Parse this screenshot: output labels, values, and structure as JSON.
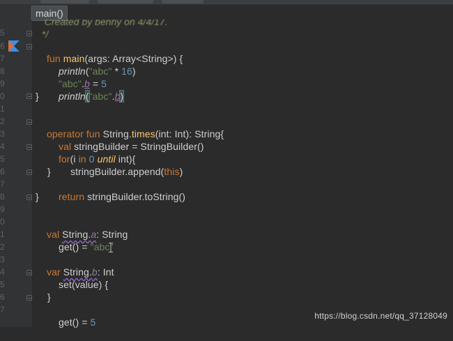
{
  "breadcrumb": "main()",
  "ghost_comment": {
    "line1": "  Created by benny on 4/4/17.",
    "line2": " */"
  },
  "gutter": {
    "line_numbers": [
      "5",
      "6",
      "7",
      "8",
      "9",
      "0",
      "1",
      "2",
      "3",
      "4",
      "5",
      "6",
      "7",
      "8",
      "9",
      "0",
      "1",
      "2",
      "3",
      "4",
      "5",
      "6",
      "7"
    ]
  },
  "code": {
    "l6": {
      "kw": "fun",
      "name": "main",
      "rest": "(args: Array<String>) {"
    },
    "l7": {
      "fn": "println",
      "open": "(",
      "str": "\"abc\"",
      "op": " * ",
      "num": "16",
      "close": ")"
    },
    "l8": {
      "str": "\"abc\"",
      "dot": ".",
      "prop": "b",
      "op": " = ",
      "num": "5"
    },
    "l9": {
      "fn": "println",
      "open": "(",
      "str": "\"abc\"",
      "dot": ".",
      "prop": "b",
      "close": ")"
    },
    "l10": "}",
    "l12": {
      "kw": "operator fun ",
      "type": "String.",
      "name": "times",
      "rest": "(int: Int): String{"
    },
    "l13": {
      "kw": "val ",
      "rest": "stringBuilder = StringBuilder()"
    },
    "l14": {
      "kw_for": "for",
      "mid": "(i ",
      "kw_in": "in",
      "num": " 0 ",
      "kw_until": "until",
      "rest": " int){"
    },
    "l15": {
      "text": "stringBuilder.append(",
      "kw": "this",
      "close": ")"
    },
    "l16": "}",
    "l17": {
      "kw": "return ",
      "rest": "stringBuilder.toString()"
    },
    "l18": "}",
    "l20": {
      "kw": "val ",
      "ext": "String.",
      "prop": "a",
      "rest": ": String"
    },
    "l21": {
      "text": "get() = ",
      "str": "\"abc\""
    },
    "l23": {
      "kw": "var ",
      "ext": "String.",
      "prop": "b",
      "rest": ": Int"
    },
    "l24": {
      "text": "set(value) {"
    },
    "l26": "}",
    "l27": {
      "text": "get() = ",
      "num": "5"
    }
  },
  "watermark": "https://blog.csdn.net/qq_37128049",
  "icons": {
    "run": "kotlin-run-gutter-icon",
    "cursor": "text-cursor-icon"
  },
  "colors": {
    "background": "#2b2b2b",
    "keyword": "#cc7832",
    "function": "#ffc66d",
    "string": "#6a8759",
    "number": "#6897bb",
    "property": "#9876aa"
  }
}
